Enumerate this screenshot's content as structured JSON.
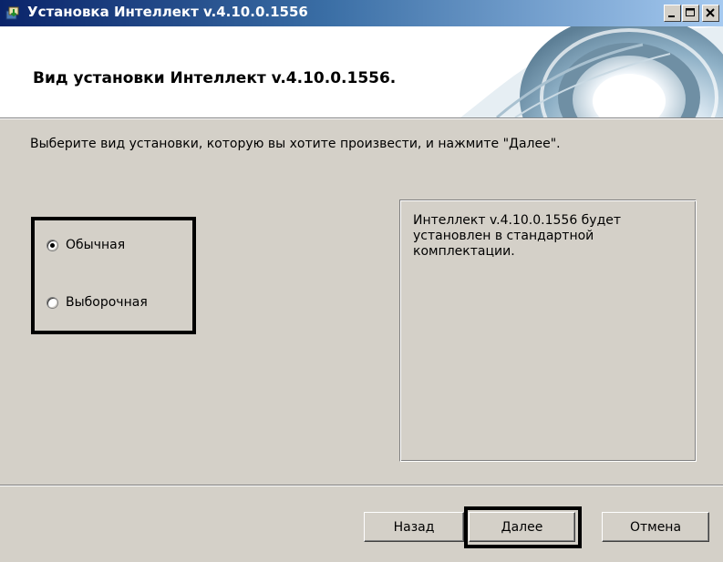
{
  "window": {
    "title": "Установка Интеллект v.4.10.0.1556",
    "controls": {
      "minimize": "minimize",
      "maximize": "maximize",
      "close": "close"
    }
  },
  "banner": {
    "title": "Вид установки Интеллект v.4.10.0.1556."
  },
  "instruction": "Выберите вид установки, которую вы хотите произвести, и нажмите \"Далее\".",
  "install_types": [
    {
      "label": "Обычная",
      "selected": true
    },
    {
      "label": "Выборочная",
      "selected": false
    }
  ],
  "description": "Интеллект v.4.10.0.1556 будет установлен в стандартной комплектации.",
  "buttons": {
    "back": "Назад",
    "next": "Далее",
    "cancel": "Отмена"
  },
  "icons": [
    "installer-icon",
    "minimize-icon",
    "maximize-icon",
    "close-icon",
    "radio-selected-icon",
    "radio-unselected-icon"
  ],
  "colors": {
    "titlebar_start": "#0a246a",
    "titlebar_end": "#a6caf0",
    "dialog_bg": "#d4d0c8",
    "highlight_border": "#000000"
  }
}
